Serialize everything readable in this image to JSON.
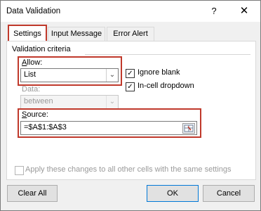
{
  "window": {
    "title": "Data Validation",
    "help_glyph": "?",
    "close_glyph": "✕"
  },
  "tabs": [
    {
      "label": "Settings",
      "active": true
    },
    {
      "label": "Input Message",
      "active": false
    },
    {
      "label": "Error Alert",
      "active": false
    }
  ],
  "criteria": {
    "group_label": "Validation criteria",
    "allow_label": "Allow:",
    "allow_value": "List",
    "data_label": "Data:",
    "data_value": "between",
    "ignore_blank_label": "Ignore blank",
    "ignore_blank_checked": true,
    "in_cell_dropdown_label": "In-cell dropdown",
    "in_cell_dropdown_checked": true,
    "source_label": "Source:",
    "source_value": "=$A$1:$A$3"
  },
  "apply_all": {
    "label": "Apply these changes to all other cells with the same settings",
    "checked": false
  },
  "buttons": {
    "clear_all": "Clear All",
    "ok": "OK",
    "cancel": "Cancel"
  },
  "colors": {
    "highlight": "#c0392b",
    "ok_border": "#0078d7"
  }
}
